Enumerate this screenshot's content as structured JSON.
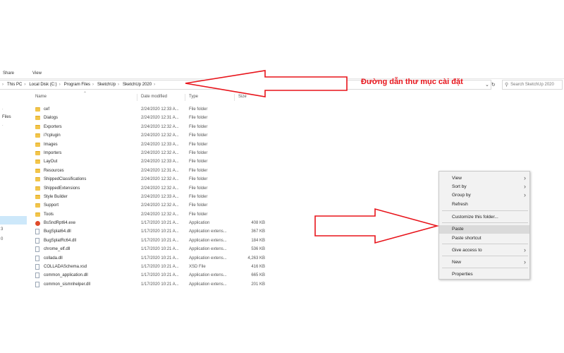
{
  "ribbon": {
    "tabs": [
      "Share",
      "View"
    ]
  },
  "address": {
    "crumbs": [
      "This PC",
      "Local Disk (C:)",
      "Program Files",
      "SketchUp",
      "SketchUp 2020"
    ],
    "search_placeholder": "Search SketchUp 2020"
  },
  "nav": {
    "files_label": "Files",
    "nums": [
      "",
      "3",
      "0"
    ]
  },
  "columns": {
    "name": "Name",
    "date": "Date modified",
    "type": "Type",
    "size": "Size"
  },
  "files": [
    {
      "name": "cef",
      "date": "2/24/2020 12:33 A...",
      "type": "File folder",
      "size": "",
      "icon": "folder-icon"
    },
    {
      "name": "Dialogs",
      "date": "2/24/2020 12:31 A...",
      "type": "File folder",
      "size": "",
      "icon": "folder-icon"
    },
    {
      "name": "Exporters",
      "date": "2/24/2020 12:32 A...",
      "type": "File folder",
      "size": "",
      "icon": "folder-icon"
    },
    {
      "name": "i?cplugin",
      "date": "2/24/2020 12:32 A...",
      "type": "File folder",
      "size": "",
      "icon": "folder-icon"
    },
    {
      "name": "Images",
      "date": "2/24/2020 12:33 A...",
      "type": "File folder",
      "size": "",
      "icon": "folder-icon"
    },
    {
      "name": "Importers",
      "date": "2/24/2020 12:32 A...",
      "type": "File folder",
      "size": "",
      "icon": "folder-icon"
    },
    {
      "name": "LayOut",
      "date": "2/24/2020 12:33 A...",
      "type": "File folder",
      "size": "",
      "icon": "folder-icon"
    },
    {
      "name": "Resources",
      "date": "2/24/2020 12:31 A...",
      "type": "File folder",
      "size": "",
      "icon": "folder-icon"
    },
    {
      "name": "ShippedClassifications",
      "date": "2/24/2020 12:32 A...",
      "type": "File folder",
      "size": "",
      "icon": "folder-icon"
    },
    {
      "name": "ShippedExtensions",
      "date": "2/24/2020 12:32 A...",
      "type": "File folder",
      "size": "",
      "icon": "folder-icon"
    },
    {
      "name": "Style Builder",
      "date": "2/24/2020 12:33 A...",
      "type": "File folder",
      "size": "",
      "icon": "folder-icon"
    },
    {
      "name": "Support",
      "date": "2/24/2020 12:32 A...",
      "type": "File folder",
      "size": "",
      "icon": "folder-icon"
    },
    {
      "name": "Tools",
      "date": "2/24/2020 12:32 A...",
      "type": "File folder",
      "size": "",
      "icon": "folder-icon"
    },
    {
      "name": "BsSndRpt64.exe",
      "date": "1/17/2020 10:21 A...",
      "type": "Application",
      "size": "408 KB",
      "icon": "app-icon"
    },
    {
      "name": "BugSplat64.dll",
      "date": "1/17/2020 10:21 A...",
      "type": "Application extens...",
      "size": "367 KB",
      "icon": "dll-icon"
    },
    {
      "name": "BugSplatRc64.dll",
      "date": "1/17/2020 10:21 A...",
      "type": "Application extens...",
      "size": "184 KB",
      "icon": "dll-icon"
    },
    {
      "name": "chrome_elf.dll",
      "date": "1/17/2020 10:21 A...",
      "type": "Application extens...",
      "size": "536 KB",
      "icon": "dll-icon"
    },
    {
      "name": "collada.dll",
      "date": "1/17/2020 10:21 A...",
      "type": "Application extens...",
      "size": "4,263 KB",
      "icon": "dll-icon"
    },
    {
      "name": "COLLADASchema.xsd",
      "date": "1/17/2020 10:21 A...",
      "type": "XSD File",
      "size": "416 KB",
      "icon": "file-icon"
    },
    {
      "name": "common_application.dll",
      "date": "1/17/2020 10:21 A...",
      "type": "Application extens...",
      "size": "665 KB",
      "icon": "dll-icon"
    },
    {
      "name": "common_sismnhelper.dll",
      "date": "1/17/2020 10:21 A...",
      "type": "Application extens...",
      "size": "201 KB",
      "icon": "dll-icon"
    }
  ],
  "context_menu": {
    "items": [
      {
        "label": "View",
        "submenu": true
      },
      {
        "label": "Sort by",
        "submenu": true
      },
      {
        "label": "Group by",
        "submenu": true
      },
      {
        "label": "Refresh",
        "submenu": false
      },
      {
        "label": "Customize this folder...",
        "submenu": false
      },
      {
        "label": "Paste",
        "submenu": false
      },
      {
        "label": "Paste shortcut",
        "submenu": false
      },
      {
        "label": "Give access to",
        "submenu": true
      },
      {
        "label": "New",
        "submenu": true
      },
      {
        "label": "Properties",
        "submenu": false
      }
    ],
    "highlighted": "Paste"
  },
  "annotation": {
    "text": "Đường dẫn thư mục cài đặt",
    "color": "#e8131a"
  }
}
